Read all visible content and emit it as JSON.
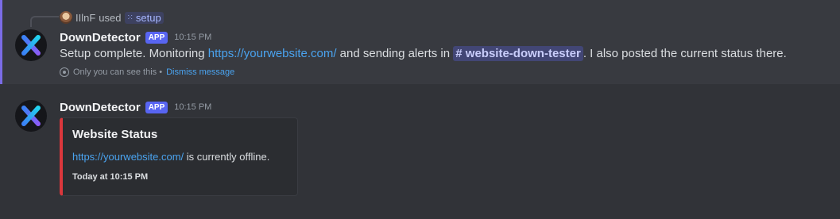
{
  "reply": {
    "user": "IIlnF",
    "used_text": "used",
    "command": "setup"
  },
  "message1": {
    "author": "DownDetector",
    "badge": "APP",
    "time": "10:15 PM",
    "text_before_link": "Setup complete. Monitoring ",
    "link": "https://yourwebsite.com/",
    "text_middle": " and sending alerts in ",
    "channel": "# website-down-tester",
    "text_after": ". I also posted the current status there.",
    "ephemeral_note": "Only you can see this •",
    "dismiss_label": "Dismiss message"
  },
  "message2": {
    "author": "DownDetector",
    "badge": "APP",
    "time": "10:15 PM",
    "embed": {
      "title": "Website Status",
      "link": "https://yourwebsite.com/",
      "desc_after": " is currently offline.",
      "footer": "Today at 10:15 PM",
      "color": "#da373c"
    }
  },
  "colors": {
    "accent": "#5865f2",
    "link": "#4aa3ef",
    "ephemeral_bar": "#7b6ce6"
  }
}
